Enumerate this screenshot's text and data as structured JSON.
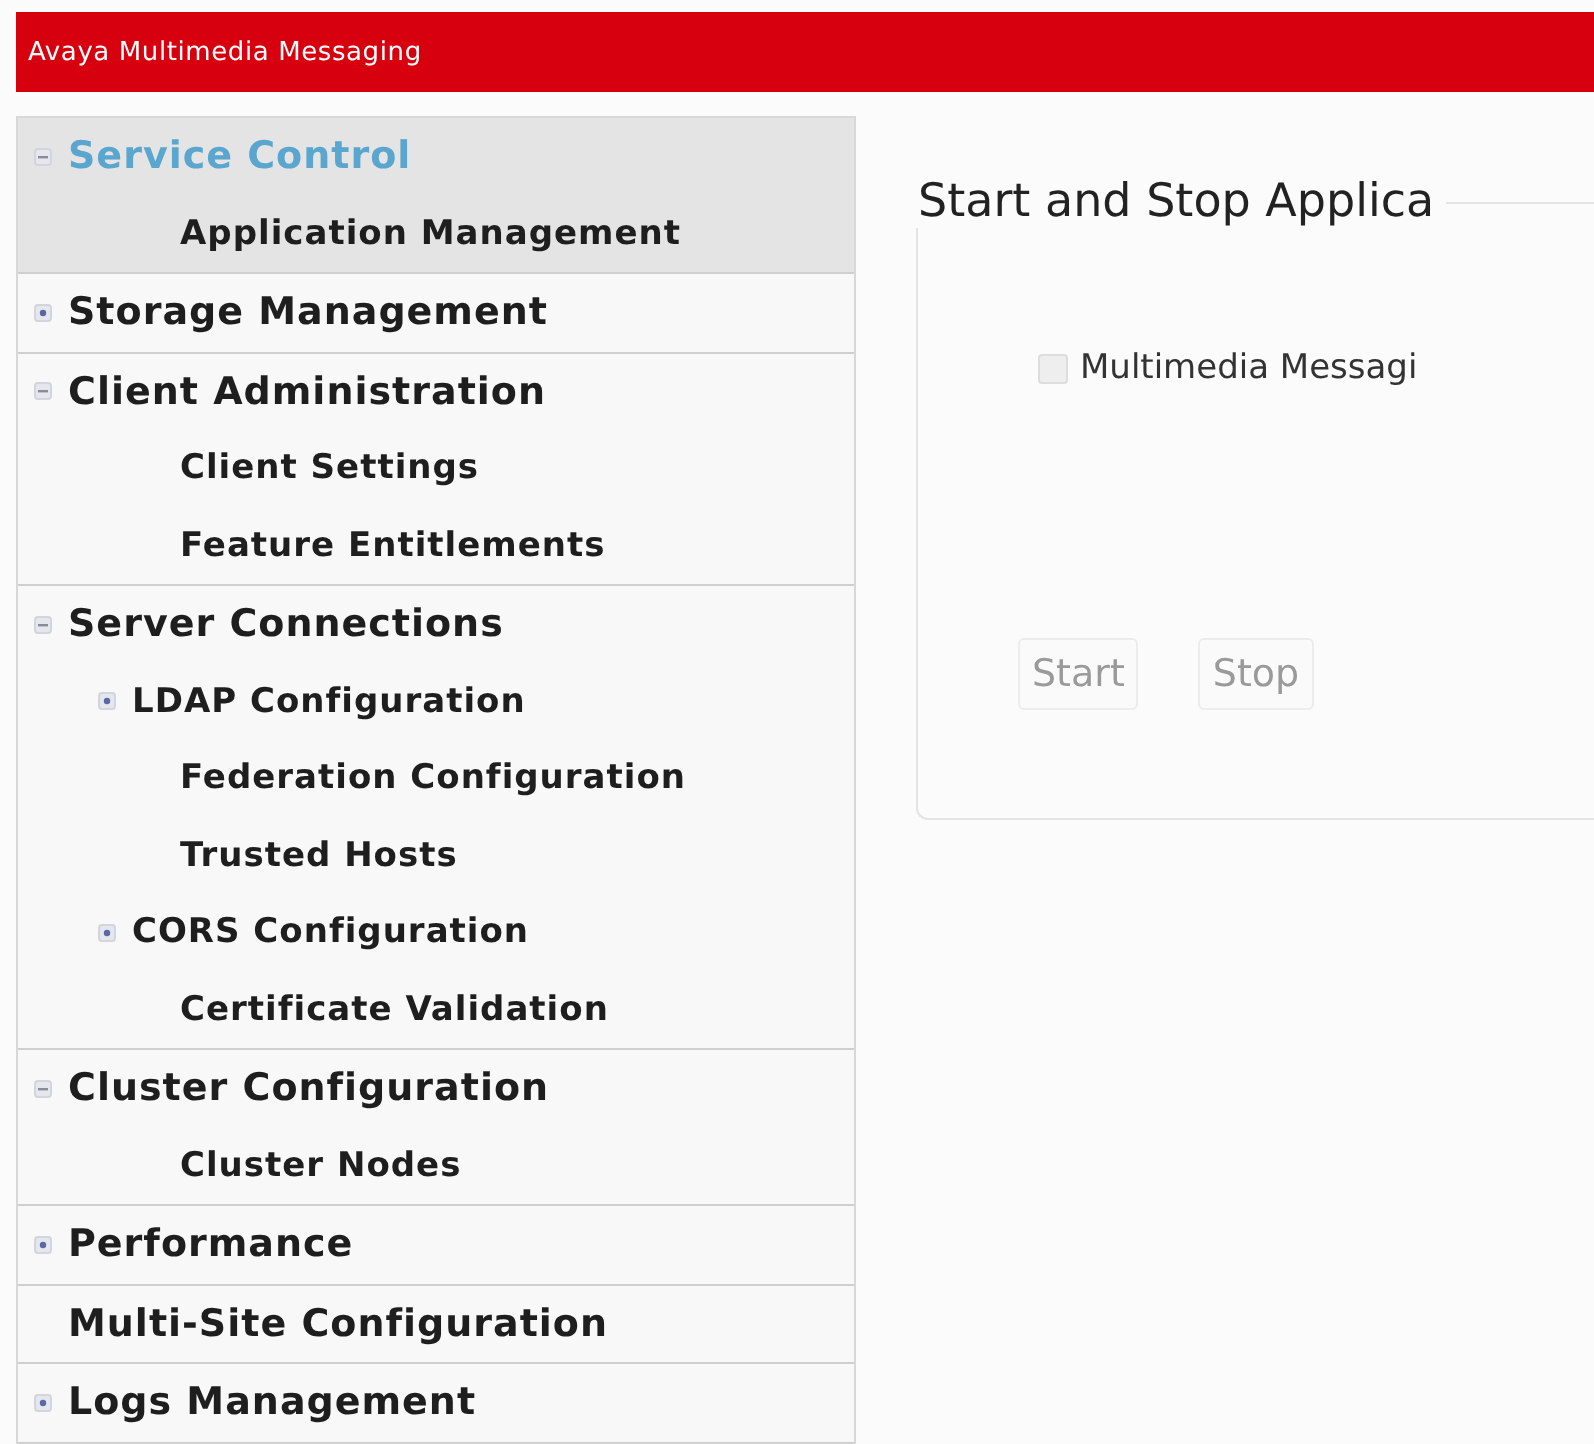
{
  "header": {
    "title": "Avaya Multimedia Messaging"
  },
  "sidebar": {
    "items": [
      {
        "label": "Service Control",
        "selected": true,
        "expanded": true,
        "children": [
          {
            "label": "Application Management"
          }
        ]
      },
      {
        "label": "Storage Management",
        "selected": false,
        "expanded": false
      },
      {
        "label": "Client Administration",
        "selected": false,
        "expanded": true,
        "children": [
          {
            "label": "Client Settings"
          },
          {
            "label": "Feature Entitlements"
          }
        ]
      },
      {
        "label": "Server Connections",
        "selected": false,
        "expanded": true,
        "children": [
          {
            "label": "LDAP Configuration",
            "expanded": false
          },
          {
            "label": "Federation Configuration"
          },
          {
            "label": "Trusted Hosts"
          },
          {
            "label": "CORS Configuration",
            "expanded": false
          },
          {
            "label": "Certificate Validation"
          }
        ]
      },
      {
        "label": "Cluster Configuration",
        "selected": false,
        "expanded": true,
        "children": [
          {
            "label": "Cluster Nodes"
          }
        ]
      },
      {
        "label": "Performance",
        "selected": false,
        "expanded": false
      },
      {
        "label": "Multi-Site Configuration",
        "selected": false
      },
      {
        "label": "Logs Management",
        "selected": false,
        "expanded": false
      }
    ]
  },
  "panel": {
    "legend": "Start and Stop Applica",
    "checkbox": {
      "label": "Multimedia Messagi",
      "checked": false,
      "disabled": true
    },
    "buttons": [
      {
        "label": "Start",
        "disabled": true
      },
      {
        "label": "Stop",
        "disabled": true
      }
    ]
  }
}
